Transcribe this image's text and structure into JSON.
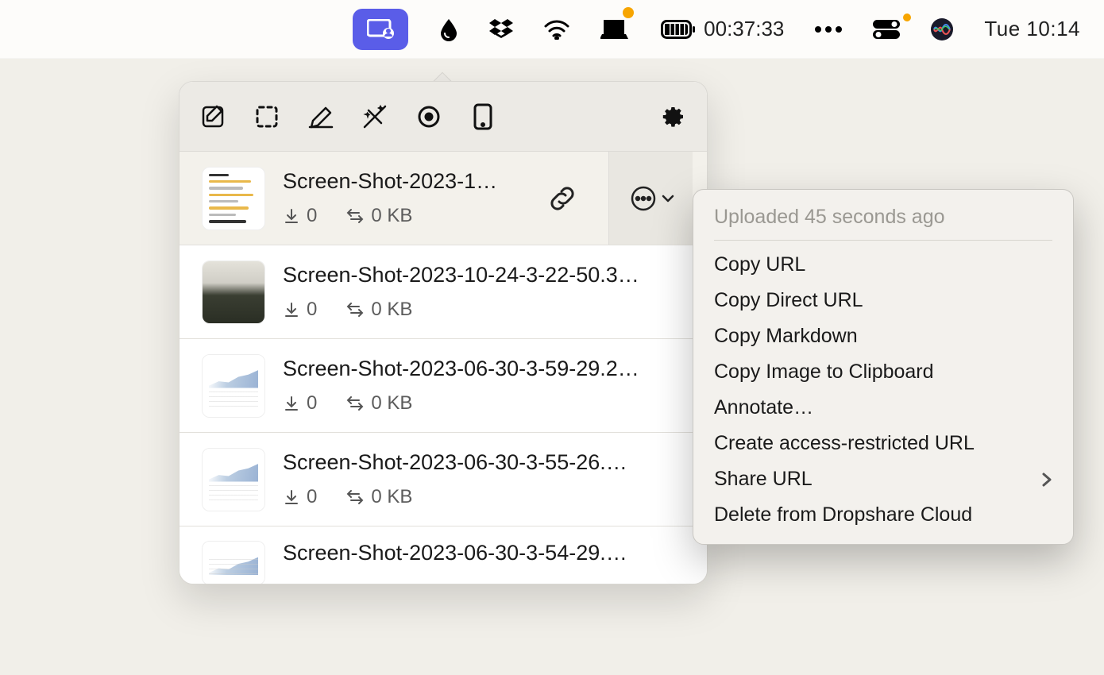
{
  "menubar": {
    "battery_time": "00:37:33",
    "clock": "Tue 10:14"
  },
  "panel": {
    "files": [
      {
        "name": "Screen-Shot-2023-1…",
        "downloads": "0",
        "size": "0 KB"
      },
      {
        "name": "Screen-Shot-2023-10-24-3-22-50.3…",
        "downloads": "0",
        "size": "0 KB"
      },
      {
        "name": "Screen-Shot-2023-06-30-3-59-29.2…",
        "downloads": "0",
        "size": "0 KB"
      },
      {
        "name": "Screen-Shot-2023-06-30-3-55-26.…",
        "downloads": "0",
        "size": "0 KB"
      },
      {
        "name": "Screen-Shot-2023-06-30-3-54-29.…",
        "downloads": "",
        "size": ""
      }
    ]
  },
  "context_menu": {
    "header": "Uploaded 45 seconds ago",
    "items": [
      {
        "label": "Copy URL",
        "submenu": false
      },
      {
        "label": "Copy Direct URL",
        "submenu": false
      },
      {
        "label": "Copy Markdown",
        "submenu": false
      },
      {
        "label": "Copy Image to Clipboard",
        "submenu": false
      },
      {
        "label": "Annotate…",
        "submenu": false
      },
      {
        "label": "Create access-restricted URL",
        "submenu": false
      },
      {
        "label": "Share URL",
        "submenu": true
      },
      {
        "label": "Delete from Dropshare Cloud",
        "submenu": false
      }
    ]
  }
}
